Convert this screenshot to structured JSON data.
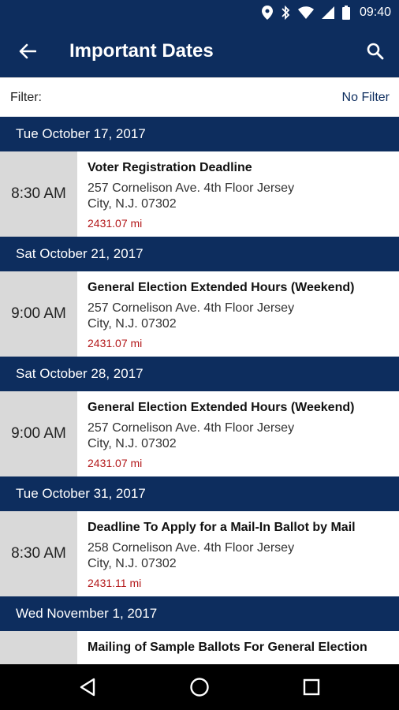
{
  "status_bar": {
    "time": "09:40",
    "icons": [
      "location-icon",
      "bluetooth-icon",
      "wifi-icon",
      "signal-icon",
      "battery-icon"
    ]
  },
  "app_bar": {
    "title": "Important Dates",
    "back_icon": "back-arrow-icon",
    "search_icon": "search-icon"
  },
  "filter": {
    "label": "Filter:",
    "value": "No Filter"
  },
  "groups": [
    {
      "date": "Tue October 17, 2017",
      "event": {
        "time": "8:30 AM",
        "name": "Voter Registration Deadline",
        "address_line1": "257 Cornelison Ave. 4th Floor Jersey",
        "address_line2": "City, N.J. 07302",
        "distance": "2431.07 mi"
      }
    },
    {
      "date": "Sat October 21, 2017",
      "event": {
        "time": "9:00 AM",
        "name": "General Election Extended Hours (Weekend)",
        "address_line1": "257 Cornelison Ave. 4th Floor Jersey",
        "address_line2": "City, N.J. 07302",
        "distance": "2431.07 mi"
      }
    },
    {
      "date": "Sat October 28, 2017",
      "event": {
        "time": "9:00 AM",
        "name": "General Election Extended Hours (Weekend)",
        "address_line1": "257 Cornelison Ave. 4th Floor Jersey",
        "address_line2": "City, N.J. 07302",
        "distance": "2431.07 mi"
      }
    },
    {
      "date": "Tue October 31, 2017",
      "event": {
        "time": "8:30 AM",
        "name": "Deadline To Apply for a Mail-In Ballot by Mail",
        "address_line1": "258 Cornelison Ave. 4th Floor Jersey",
        "address_line2": "City, N.J. 07302",
        "distance": "2431.11 mi"
      }
    },
    {
      "date": "Wed November 1, 2017",
      "event": {
        "time": "",
        "name": "Mailing of Sample Ballots For General Election",
        "address_line1": "",
        "address_line2": "",
        "distance": ""
      }
    }
  ],
  "colors": {
    "primary": "#0d2d5e",
    "time_column": "#d9d9d9",
    "distance": "#b3181a",
    "nav_bar": "#000000"
  },
  "nav_bar": {
    "buttons": [
      "back-triangle-icon",
      "home-circle-icon",
      "recents-square-icon"
    ]
  }
}
